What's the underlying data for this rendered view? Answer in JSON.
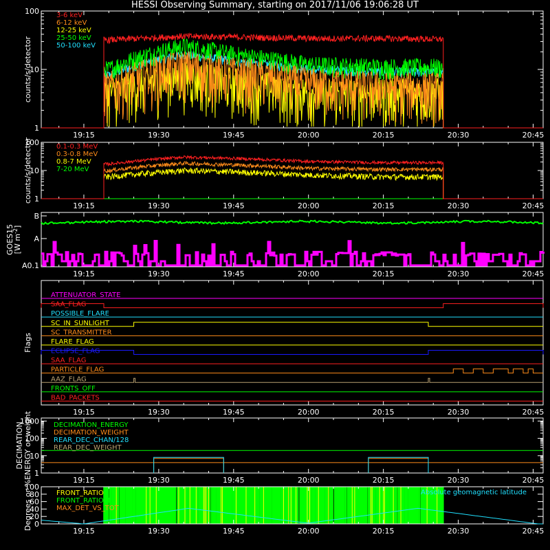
{
  "title": "HESSI Observing Summary, starting on 2017/11/06 19:06:28 UT",
  "colors": {
    "background": "#000000",
    "axes": "#ffffff",
    "red": "#ff2020",
    "orange": "#ff8c1a",
    "yellow": "#ffff00",
    "green": "#00ff00",
    "cyan": "#20e0ff",
    "magenta": "#ff00ff",
    "blue": "#1a1aff",
    "olive": "#b8a070"
  },
  "time_axis": {
    "start": "19:06:28",
    "end": "20:47",
    "ticks": [
      "19:15",
      "19:30",
      "19:45",
      "20:00",
      "20:15",
      "20:30",
      "20:45"
    ]
  },
  "chart_data": [
    {
      "id": "low-energy",
      "type": "line",
      "ylabel": "counts/s/detector",
      "yscale": "log",
      "ylim": [
        1,
        100
      ],
      "yticks": [
        "1",
        "10",
        "100"
      ],
      "on_time": [
        "19:19",
        "20:27"
      ],
      "series": [
        {
          "name": "3-6 keV",
          "color": "red",
          "values": [
            {
              "t": "19:20",
              "v": 32
            },
            {
              "t": "19:35",
              "v": 37
            },
            {
              "t": "19:45",
              "v": 36
            },
            {
              "t": "20:00",
              "v": 34
            },
            {
              "t": "20:15",
              "v": 34
            },
            {
              "t": "20:27",
              "v": 33
            }
          ],
          "noise": 0.08
        },
        {
          "name": "6-12 keV",
          "color": "orange",
          "values": [
            {
              "t": "19:20",
              "v": 5
            },
            {
              "t": "19:35",
              "v": 12
            },
            {
              "t": "19:45",
              "v": 9
            },
            {
              "t": "20:00",
              "v": 6
            },
            {
              "t": "20:15",
              "v": 5
            },
            {
              "t": "20:27",
              "v": 5
            }
          ],
          "noise": 0.5
        },
        {
          "name": "12-25 keV",
          "color": "yellow",
          "values": [
            {
              "t": "19:20",
              "v": 4
            },
            {
              "t": "19:35",
              "v": 8
            },
            {
              "t": "19:45",
              "v": 6
            },
            {
              "t": "20:00",
              "v": 4
            },
            {
              "t": "20:15",
              "v": 4
            },
            {
              "t": "20:27",
              "v": 4
            }
          ],
          "noise": 0.5
        },
        {
          "name": "25-50 keV",
          "color": "green",
          "values": [
            {
              "t": "19:20",
              "v": 10
            },
            {
              "t": "19:35",
              "v": 25
            },
            {
              "t": "19:45",
              "v": 18
            },
            {
              "t": "20:00",
              "v": 12
            },
            {
              "t": "20:15",
              "v": 11
            },
            {
              "t": "20:27",
              "v": 11
            }
          ],
          "noise": 0.25
        },
        {
          "name": "50-100 keV",
          "color": "cyan",
          "values": [
            {
              "t": "19:20",
              "v": 8
            },
            {
              "t": "19:35",
              "v": 18
            },
            {
              "t": "19:45",
              "v": 14
            },
            {
              "t": "20:00",
              "v": 10
            },
            {
              "t": "20:15",
              "v": 9
            },
            {
              "t": "20:27",
              "v": 9
            }
          ],
          "noise": 0.12
        }
      ]
    },
    {
      "id": "high-energy",
      "type": "line",
      "ylabel": "counts/s/detector",
      "yscale": "log",
      "ylim": [
        1,
        100
      ],
      "yticks": [
        "1",
        "10",
        "100"
      ],
      "on_time": [
        "19:19",
        "20:27"
      ],
      "series": [
        {
          "name": "0.1-0.3 MeV",
          "color": "red",
          "values": [
            {
              "t": "19:20",
              "v": 17
            },
            {
              "t": "19:35",
              "v": 30
            },
            {
              "t": "19:45",
              "v": 27
            },
            {
              "t": "20:00",
              "v": 21
            },
            {
              "t": "20:15",
              "v": 19
            },
            {
              "t": "20:27",
              "v": 19
            }
          ],
          "noise": 0.08
        },
        {
          "name": "0.3-0.8 MeV",
          "color": "orange",
          "values": [
            {
              "t": "19:20",
              "v": 10
            },
            {
              "t": "19:35",
              "v": 18
            },
            {
              "t": "19:45",
              "v": 16
            },
            {
              "t": "20:00",
              "v": 12
            },
            {
              "t": "20:15",
              "v": 11
            },
            {
              "t": "20:27",
              "v": 11
            }
          ],
          "noise": 0.1
        },
        {
          "name": "0.8-7 MeV",
          "color": "yellow",
          "values": [
            {
              "t": "19:20",
              "v": 6
            },
            {
              "t": "19:35",
              "v": 10
            },
            {
              "t": "19:45",
              "v": 9
            },
            {
              "t": "20:00",
              "v": 7
            },
            {
              "t": "20:15",
              "v": 6
            },
            {
              "t": "20:27",
              "v": 6
            }
          ],
          "noise": 0.15
        },
        {
          "name": "7-20 MeV",
          "color": "green",
          "values": [
            {
              "t": "19:06:28",
              "v": 1
            },
            {
              "t": "20:47",
              "v": 1
            }
          ],
          "noise": 0
        }
      ]
    },
    {
      "id": "goes",
      "type": "line",
      "ylabel": "GOES15 [W m-2]",
      "ylabel_top": "GOES15",
      "ylabel_bottom": "[W m",
      "ylabel_sup": "-2",
      "yticks": [
        "A0.1",
        "A",
        "B"
      ],
      "series": [
        {
          "name": "GOES long",
          "color": "green",
          "level": 0.82
        },
        {
          "name": "GOES short",
          "color": "magenta",
          "level": 0.12
        }
      ]
    },
    {
      "id": "flags",
      "type": "flags",
      "ylabel": "Flags",
      "flags": [
        {
          "name": "ATTENUATOR_STATE",
          "color": "magenta",
          "state": "off"
        },
        {
          "name": "SAA_FLAG",
          "color": "red",
          "state": "on",
          "segments": [
            [
              "19:06:28",
              "19:19"
            ],
            [
              "20:27",
              "20:47"
            ]
          ]
        },
        {
          "name": "POSSIBLE_FLARE",
          "color": "cyan",
          "state": "off"
        },
        {
          "name": "SC_IN_SUNLIGHT",
          "color": "yellow",
          "state": "on",
          "segments": [
            [
              "19:25",
              "20:24"
            ]
          ]
        },
        {
          "name": "SC_TRANSMITTER",
          "color": "orange",
          "state": "off"
        },
        {
          "name": "FLARE_FLAG",
          "color": "yellow",
          "state": "off"
        },
        {
          "name": "ECLIPSE_FLAG",
          "color": "blue",
          "state": "on",
          "segments": [
            [
              "19:06:28",
              "19:25"
            ],
            [
              "20:24",
              "20:47"
            ]
          ]
        },
        {
          "name": "SAA_FLAG",
          "color": "red",
          "state": "off"
        },
        {
          "name": "PARTICLE_FLAG",
          "color": "orange",
          "state": "on",
          "segments": [
            [
              "20:29",
              "20:31"
            ],
            [
              "20:33",
              "20:35"
            ],
            [
              "20:37",
              "20:40"
            ],
            [
              "20:41",
              "20:43"
            ],
            [
              "20:44",
              "20:45"
            ]
          ]
        },
        {
          "name": "AAZ_FLAG",
          "color": "olive",
          "state": "spikes",
          "spikes": [
            "19:25",
            "20:24"
          ]
        },
        {
          "name": "FRONTS_OFF",
          "color": "green",
          "state": "off"
        },
        {
          "name": "BAD_PACKETS",
          "color": "red",
          "state": "off"
        }
      ]
    },
    {
      "id": "decimation",
      "type": "line",
      "ylabel": "DECIMATION ENERGY or weight",
      "ylabel_top": "DECIMATION",
      "ylabel_bottom": "ENERGY or weight",
      "yscale": "log",
      "ylim": [
        1,
        1500
      ],
      "yticks": [
        "1",
        "10",
        "100",
        "1000"
      ],
      "series": [
        {
          "name": "DECIMATION_ENERGY",
          "color": "green",
          "constant": 20
        },
        {
          "name": "DECIMATION_WEIGHT",
          "color": "orange",
          "constant": 4,
          "boxes": [
            [
              "19:29",
              "19:43"
            ],
            [
              "20:12",
              "20:24"
            ]
          ],
          "box_low": 1,
          "box_high": 7
        },
        {
          "name": "REAR_DEC_CHAN/128",
          "color": "cyan",
          "constant": 0,
          "boxes": [
            [
              "19:29",
              "19:43"
            ],
            [
              "20:12",
              "20:24"
            ]
          ],
          "box_low": 1,
          "box_high": 8
        },
        {
          "name": "REAR_DEC_WEIGHT",
          "color": "olive",
          "constant": 0
        }
      ]
    },
    {
      "id": "ratios",
      "type": "line",
      "ylabel": "Degrees or %",
      "ylim": [
        0,
        100
      ],
      "yticks": [
        "0",
        "20",
        "40",
        "60",
        "80",
        "100"
      ],
      "annotation": "Absolute geomagnetic latitude",
      "series": [
        {
          "name": "FRONT_RATIO",
          "color": "yellow"
        },
        {
          "name": "FRONT_RATIO_1",
          "color": "green"
        },
        {
          "name": "MAX_DET_VS_TOT",
          "color": "orange"
        }
      ],
      "geomag_latitude": [
        {
          "t": "19:06:28",
          "v": 10
        },
        {
          "t": "19:15",
          "v": 0
        },
        {
          "t": "19:36",
          "v": 42
        },
        {
          "t": "19:58",
          "v": 5
        },
        {
          "t": "20:00",
          "v": 2
        },
        {
          "t": "20:22",
          "v": 42
        },
        {
          "t": "20:46",
          "v": 0
        }
      ],
      "front_ratio_on": [
        "19:19",
        "20:27"
      ]
    }
  ]
}
